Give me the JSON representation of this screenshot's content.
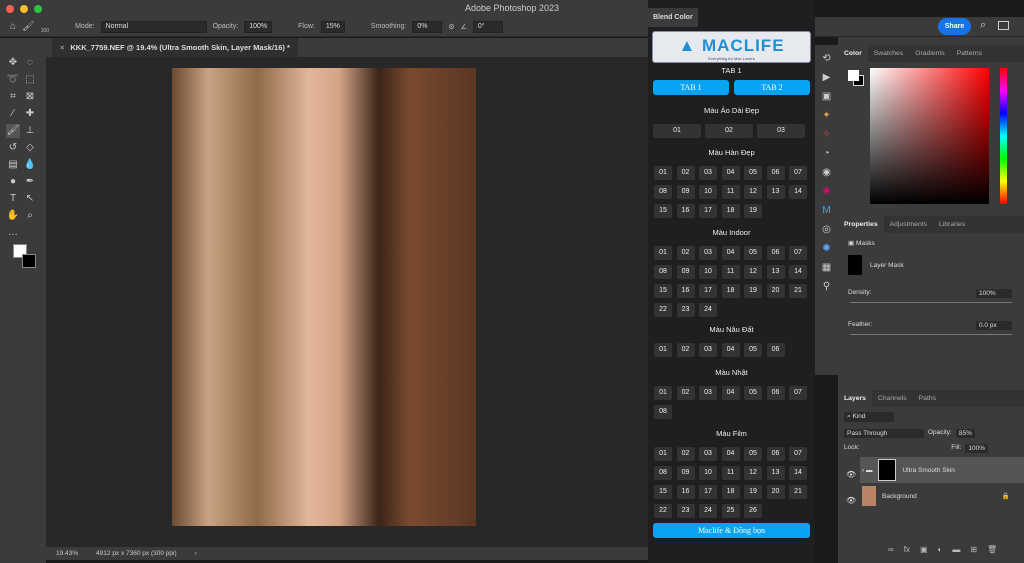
{
  "app": {
    "title": "Adobe Photoshop 2023"
  },
  "options": {
    "brush_size": "100",
    "mode_label": "Mode:",
    "mode": "Normal",
    "opacity_label": "Opacity:",
    "opacity": "100%",
    "flow_label": "Flow:",
    "flow": "15%",
    "smoothing_label": "Smoothing:",
    "smoothing": "0%",
    "angle": "0°",
    "share": "Share"
  },
  "document": {
    "tab": "KKK_7759.NEF @ 19.4% (Ultra Smooth Skin, Layer Mask/16) *",
    "zoom": "19.43%",
    "dimensions": "4912 px x 7360 px (300 ppi)"
  },
  "blend": {
    "tab": "Blend Color",
    "logo": "MACLIFE",
    "logo_tagline": "Everything for Mac Lovers",
    "tab_heading": "TAB 1",
    "tab1": "TAB 1",
    "tab2": "TAB 2",
    "footer": "Maclife & Đồng bọn",
    "sections": [
      {
        "title": "Màu Áo Dài Đẹp",
        "buttons": [
          "01",
          "02",
          "03"
        ]
      },
      {
        "title": "Màu Hàn Đẹp",
        "buttons": [
          "01",
          "02",
          "03",
          "04",
          "05",
          "06",
          "07",
          "08",
          "09",
          "10",
          "11",
          "12",
          "13",
          "14",
          "15",
          "16",
          "17",
          "18",
          "19"
        ]
      },
      {
        "title": "Màu Indoor",
        "buttons": [
          "01",
          "02",
          "03",
          "04",
          "05",
          "06",
          "07",
          "08",
          "09",
          "10",
          "11",
          "12",
          "13",
          "14",
          "15",
          "16",
          "17",
          "18",
          "19",
          "20",
          "21",
          "22",
          "23",
          "24"
        ]
      },
      {
        "title": "Màu Nâu Đất",
        "buttons": [
          "01",
          "02",
          "03",
          "04",
          "05",
          "06"
        ]
      },
      {
        "title": "Màu Nhật",
        "buttons": [
          "01",
          "02",
          "03",
          "04",
          "05",
          "06",
          "07",
          "08"
        ]
      },
      {
        "title": "Màu Film",
        "buttons": [
          "01",
          "02",
          "03",
          "04",
          "05",
          "06",
          "07",
          "08",
          "09",
          "10",
          "11",
          "12",
          "13",
          "14",
          "15",
          "16",
          "17",
          "18",
          "19",
          "20",
          "21",
          "22",
          "23",
          "24",
          "25",
          "26"
        ]
      }
    ]
  },
  "color_panel": {
    "tabs": [
      "Color",
      "Swatches",
      "Gradients",
      "Patterns"
    ]
  },
  "properties": {
    "tabs": [
      "Properties",
      "Adjustments",
      "Libraries"
    ],
    "masks": "Masks",
    "layer_mask": "Layer Mask",
    "density_label": "Density:",
    "density": "100%",
    "feather_label": "Feather:",
    "feather": "0.0 px"
  },
  "layers": {
    "tabs": [
      "Layers",
      "Channels",
      "Paths"
    ],
    "kind": "Kind",
    "blend_mode": "Pass Through",
    "opacity_label": "Opacity:",
    "opacity": "85%",
    "lock_label": "Lock:",
    "fill_label": "Fill:",
    "fill": "100%",
    "items": [
      "Ultra Smooth Skin",
      "Background"
    ]
  },
  "colors": {
    "accent": "#08a4f2",
    "share": "#1473e6"
  }
}
